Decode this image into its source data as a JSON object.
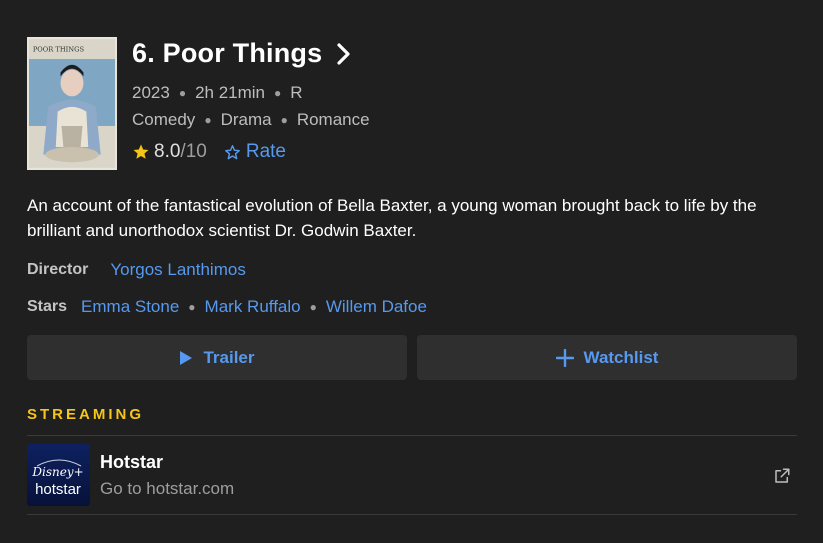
{
  "movie": {
    "title": "6. Poor Things",
    "year": "2023",
    "runtime": "2h 21min",
    "certificate": "R",
    "genres": [
      "Comedy",
      "Drama",
      "Romance"
    ],
    "rating": "8.0",
    "rating_max": "/10",
    "rate_label": "Rate",
    "description": "An account of the fantastical evolution of Bella Baxter, a young woman brought back to life by the brilliant and unorthodox scientist Dr. Godwin Baxter.",
    "director_label": "Director",
    "director": "Yorgos Lanthimos",
    "stars_label": "Stars",
    "stars": [
      "Emma Stone",
      "Mark Ruffalo",
      "Willem Dafoe"
    ]
  },
  "poster": {
    "title_text": "POOR THINGS"
  },
  "actions": {
    "trailer_label": "Trailer",
    "watchlist_label": "Watchlist"
  },
  "streaming": {
    "section_title": "STREAMING",
    "provider": {
      "name": "Hotstar",
      "subtitle": "Go to hotstar.com",
      "logo_text_top": "Disney+",
      "logo_text_bottom": "hotstar"
    }
  },
  "icons": {
    "chevron": "chevron-right-icon",
    "star": "star-filled-icon",
    "rate": "star-outline-icon",
    "play": "play-icon",
    "plus": "plus-icon",
    "external": "external-link-icon"
  },
  "colors": {
    "background": "#1f1f1f",
    "link": "#5799ef",
    "accent": "#f5c518",
    "button_bg": "#2f2f2f"
  }
}
